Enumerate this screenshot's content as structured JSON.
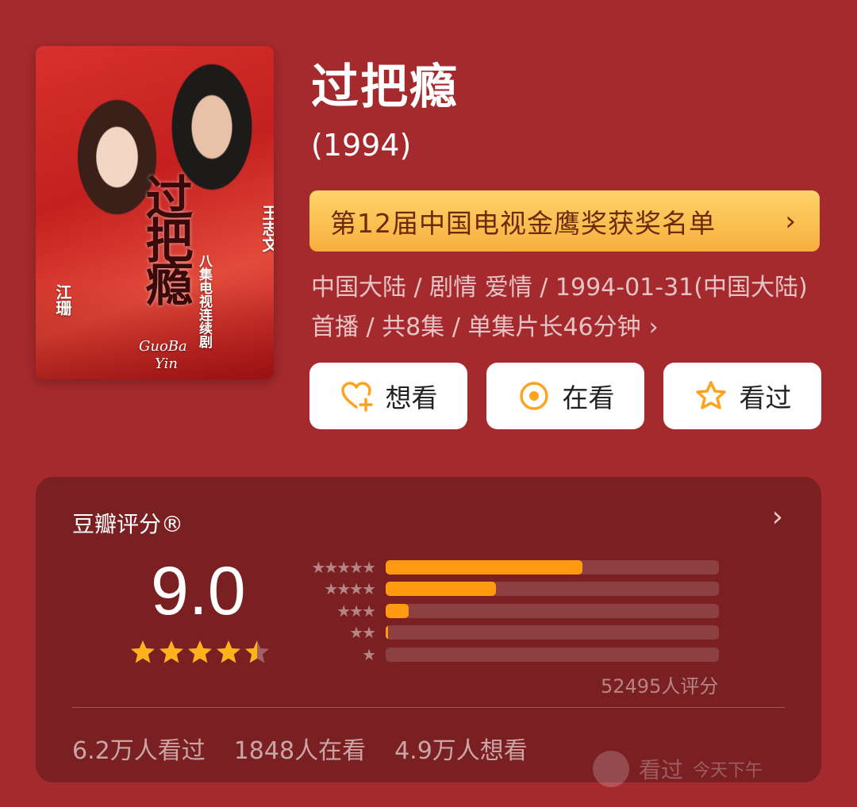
{
  "poster": {
    "big_title": "过把瘾",
    "actor_right": "王志文",
    "actor_left": "江珊",
    "series_tag": "八集电视连续剧",
    "latin_line1": "GuoBa",
    "latin_line2": "Yin"
  },
  "header": {
    "title": "过把瘾",
    "year": "(1994)"
  },
  "award": {
    "label": "第12届中国电视金鹰奖获奖名单",
    "chevron": "›"
  },
  "meta": {
    "text": "中国大陆 / 剧情 爱情 / 1994-01-31(中国大陆)首播 / 共8集 / 单集片长46分钟",
    "chevron": "›"
  },
  "actions": [
    {
      "label": "想看",
      "icon": "heart-plus-icon"
    },
    {
      "label": "在看",
      "icon": "target-icon"
    },
    {
      "label": "看过",
      "icon": "star-outline-icon"
    }
  ],
  "rating": {
    "title": "豆瓣评分®",
    "score": "9.0",
    "stars_value": 4.5,
    "distribution": [
      {
        "stars": "★★★★★",
        "fraction": 0.59
      },
      {
        "stars": "★★★★",
        "fraction": 0.33
      },
      {
        "stars": "★★★",
        "fraction": 0.07
      },
      {
        "stars": "★★",
        "fraction": 0.006
      },
      {
        "stars": "★",
        "fraction": 0.0
      }
    ],
    "count_text": "52495人评分",
    "chevron": "›"
  },
  "stats": {
    "watched": "6.2万人看过",
    "watching": "1848人在看",
    "wish": "4.9万人想看"
  },
  "watermark": {
    "label": "看过",
    "sub": "今天下午"
  },
  "colors": {
    "background": "#a52a2d",
    "card": "#7a1f22",
    "accent_orange": "#ff9a10",
    "star": "#ffb21c",
    "banner_top": "#ffd46b",
    "banner_bottom": "#f7ae3d"
  }
}
